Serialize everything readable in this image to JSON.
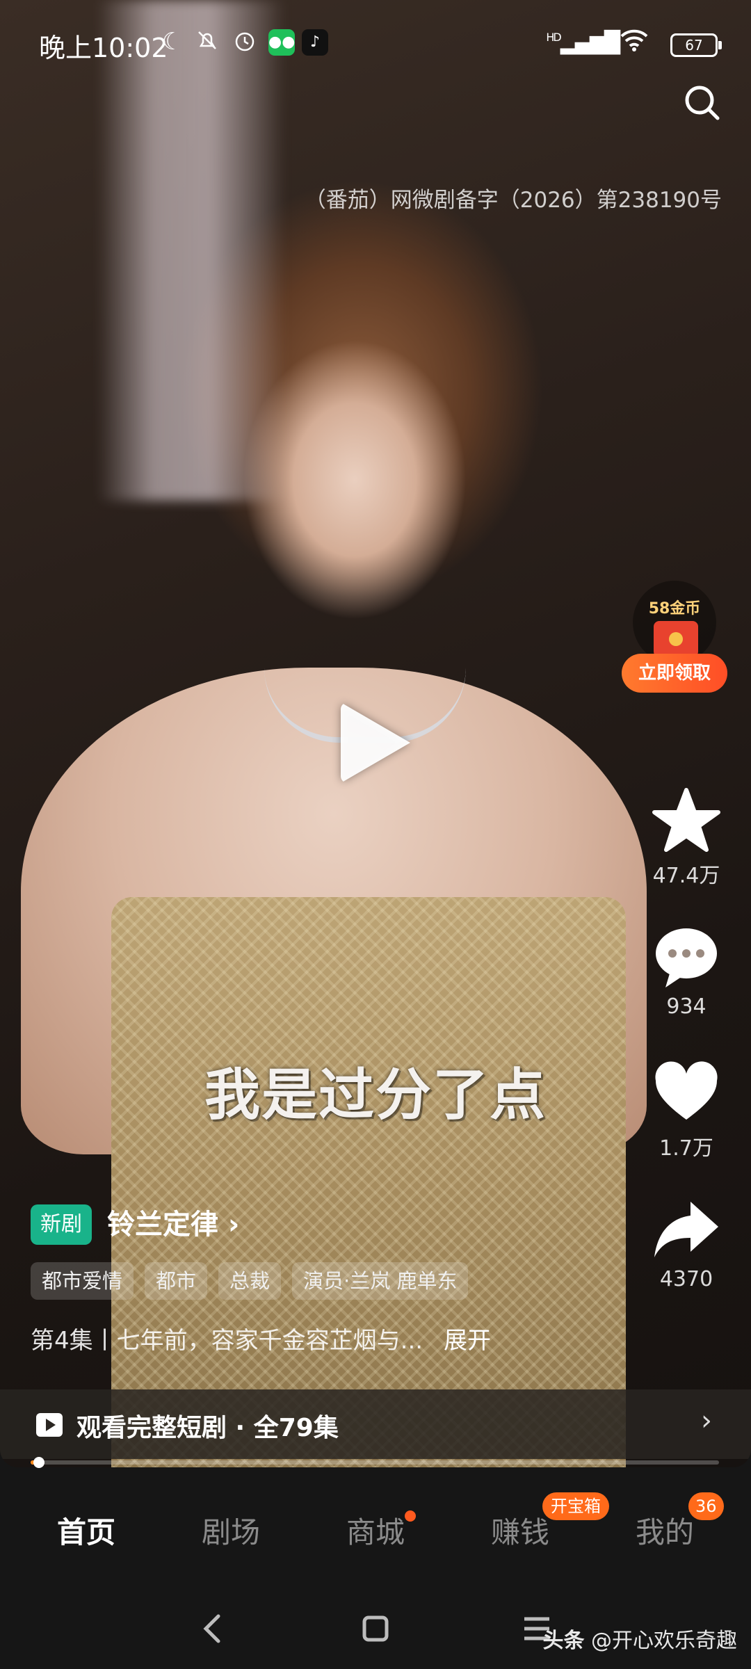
{
  "status_bar": {
    "time": "晚上10:02",
    "network": "HD",
    "battery": "67"
  },
  "license": "（番茄）网微剧备字（2026）第238190号",
  "reward": {
    "coins": "58金币",
    "button": "立即领取"
  },
  "subtitle": "我是过分了点",
  "actions": {
    "favorite": "47.4万",
    "comments": "934",
    "likes": "1.7万",
    "share": "4370"
  },
  "drama": {
    "badge": "新剧",
    "title": "铃兰定律 ›",
    "tags": [
      "都市爱情",
      "都市",
      "总裁",
      "演员·兰岚 鹿单东"
    ],
    "description": "第4集丨七年前，容家千金容芷烟与...",
    "expand": "展开"
  },
  "full_series": {
    "label": "观看完整短剧 · 全79集",
    "chevron": "›"
  },
  "playback_progress": 0.01,
  "tabbar": {
    "tabs": [
      "首页",
      "剧场",
      "商城",
      "赚钱",
      "我的"
    ],
    "active": "首页",
    "earn_badge": "开宝箱",
    "me_badge": "36"
  },
  "watermark": {
    "brand": "头条",
    "handle": "@开心欢乐奇趣"
  },
  "colors": {
    "accent": "#ff6a1a",
    "new_badge": "#19b38a"
  }
}
